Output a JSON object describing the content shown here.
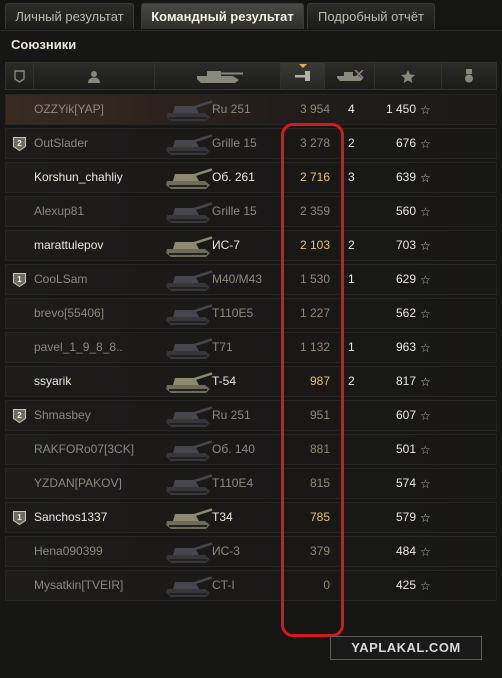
{
  "tabs": [
    {
      "label": "Личный результат",
      "active": false
    },
    {
      "label": "Командный результат",
      "active": true
    },
    {
      "label": "Подробный отчёт",
      "active": false
    }
  ],
  "section": {
    "title": "Союзники"
  },
  "columns": [
    {
      "name": "platoon",
      "icon": "platoon-icon"
    },
    {
      "name": "player",
      "icon": "player-icon"
    },
    {
      "name": "tank",
      "icon": "tank-icon"
    },
    {
      "name": "damage",
      "icon": "damage-icon",
      "sorted": true
    },
    {
      "name": "kills",
      "icon": "kills-icon"
    },
    {
      "name": "experience",
      "icon": "star-icon"
    },
    {
      "name": "medals",
      "icon": "medal-icon"
    }
  ],
  "rows": [
    {
      "platoon": "",
      "name": "OZZYik[YAP]",
      "tank": "Ru 251",
      "damage": "3 954",
      "kills": "4",
      "xp": "1 450",
      "alive": false,
      "highlight": true
    },
    {
      "platoon": "2",
      "name": "OutSlader",
      "tank": "Grille 15",
      "damage": "3 278",
      "kills": "2",
      "xp": "676",
      "alive": false,
      "highlight": false
    },
    {
      "platoon": "",
      "name": "Korshun_chahliy",
      "tank": "Об. 261",
      "damage": "2 716",
      "kills": "3",
      "xp": "639",
      "alive": true,
      "highlight": false
    },
    {
      "platoon": "",
      "name": "Alexup81",
      "tank": "Grille 15",
      "damage": "2 359",
      "kills": "",
      "xp": "560",
      "alive": false,
      "highlight": false
    },
    {
      "platoon": "",
      "name": "marattulepov",
      "tank": "ИС-7",
      "damage": "2 103",
      "kills": "2",
      "xp": "703",
      "alive": true,
      "highlight": false
    },
    {
      "platoon": "1",
      "name": "CooLSam",
      "tank": "M40/M43",
      "damage": "1 530",
      "kills": "1",
      "xp": "629",
      "alive": false,
      "highlight": false
    },
    {
      "platoon": "",
      "name": "brevo[55406]",
      "tank": "T110E5",
      "damage": "1 227",
      "kills": "",
      "xp": "562",
      "alive": false,
      "highlight": false
    },
    {
      "platoon": "",
      "name": "pavel_1_9_8_8..",
      "tank": "T71",
      "damage": "1 132",
      "kills": "1",
      "xp": "963",
      "alive": false,
      "highlight": false
    },
    {
      "platoon": "",
      "name": "ssyarik",
      "tank": "T-54",
      "damage": "987",
      "kills": "2",
      "xp": "817",
      "alive": true,
      "highlight": false
    },
    {
      "platoon": "2",
      "name": "Shmasbey",
      "tank": "Ru 251",
      "damage": "951",
      "kills": "",
      "xp": "607",
      "alive": false,
      "highlight": false
    },
    {
      "platoon": "",
      "name": "RAKFORo07[3CK]",
      "tank": "Об. 140",
      "damage": "881",
      "kills": "",
      "xp": "501",
      "alive": false,
      "highlight": false
    },
    {
      "platoon": "",
      "name": "YZDAN[PAKOV]",
      "tank": "T110E4",
      "damage": "815",
      "kills": "",
      "xp": "574",
      "alive": false,
      "highlight": false
    },
    {
      "platoon": "1",
      "name": "Sanchos1337",
      "tank": "T34",
      "damage": "785",
      "kills": "",
      "xp": "579",
      "alive": true,
      "highlight": false
    },
    {
      "platoon": "",
      "name": "Hena090399",
      "tank": "ИС-3",
      "damage": "379",
      "kills": "",
      "xp": "484",
      "alive": false,
      "highlight": false
    },
    {
      "platoon": "",
      "name": "Mysatkin[TVEIR]",
      "tank": "CT-I",
      "damage": "0",
      "kills": "",
      "xp": "425",
      "alive": false,
      "highlight": false
    }
  ],
  "star_glyph": "☆",
  "colors": {
    "alive_damage": "#e8c36a",
    "dead_damage": "#8f8a78",
    "highlight_box": "#d51a1a"
  },
  "watermark": "YAPLAKAL.COM"
}
